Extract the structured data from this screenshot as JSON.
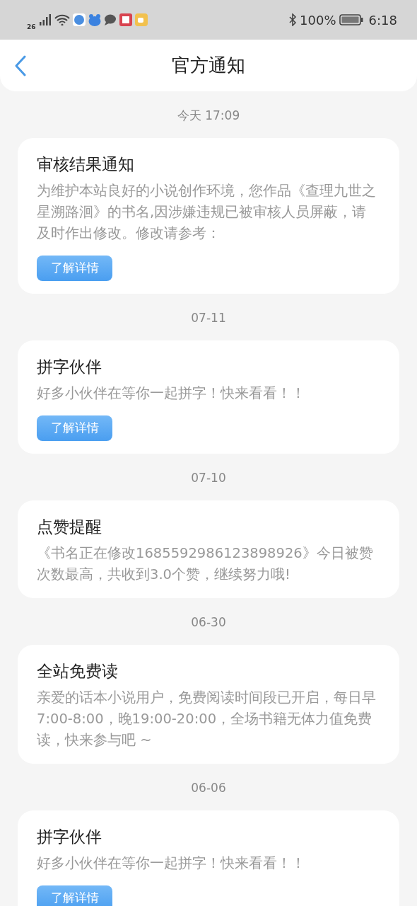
{
  "status_bar": {
    "network": "26",
    "battery": "100%",
    "time": "6:18"
  },
  "header": {
    "title": "官方通知"
  },
  "notices": [
    {
      "date": "今天 17:09",
      "title": "审核结果通知",
      "body": "为维护本站良好的小说创作环境，您作品《查理九世之星溯路洄》的书名,因涉嫌违规已被审核人员屏蔽，请及时作出修改。修改请参考：",
      "button": "了解详情"
    },
    {
      "date": "07-11",
      "title": "拼字伙伴",
      "body": "好多小伙伴在等你一起拼字！快来看看！！",
      "button": "了解详情"
    },
    {
      "date": "07-10",
      "title": "点赞提醒",
      "body": "《书名正在修改1685592986123898926》今日被赞次数最高，共收到3.0个赞，继续努力哦!"
    },
    {
      "date": "06-30",
      "title": "全站免费读",
      "body": "亲爱的话本小说用户，免费阅读时间段已开启，每日早7:00-8:00，晚19:00-20:00，全场书籍无体力值免费读，快来参与吧 ~"
    },
    {
      "date": "06-06",
      "title": "拼字伙伴",
      "body": "好多小伙伴在等你一起拼字！快来看看！！",
      "button": "了解详情"
    }
  ]
}
